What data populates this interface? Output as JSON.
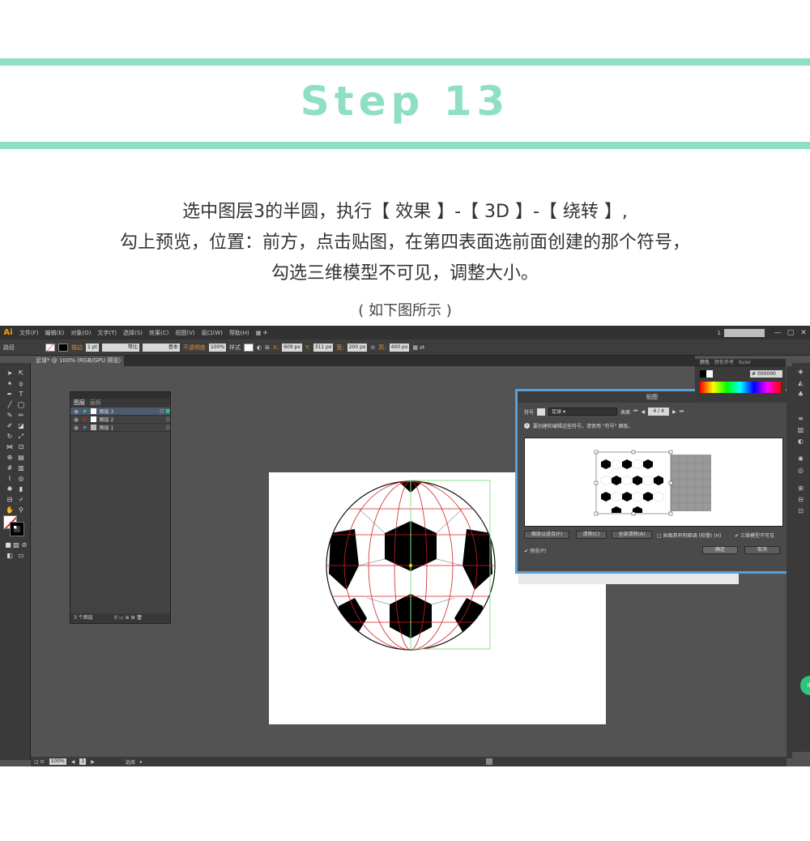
{
  "header": {
    "step_title": "Step 13",
    "instruction_lines": [
      "选中图层3的半圆，执行【 效果 】-【 3D 】-【 绕转 】,",
      "勾上预览，位置：前方，点击贴图，在第四表面选前面创建的那个符号，",
      "勾选三维模型不可见，调整大小。"
    ],
    "caption": "( 如下图所示 )",
    "accent_color": "#8fe0c3"
  },
  "app": {
    "logo": "Ai",
    "menus": [
      "文件(F)",
      "编辑(E)",
      "对象(O)",
      "文字(T)",
      "选择(S)",
      "效果(C)",
      "视图(V)",
      "窗口(W)",
      "帮助(H)"
    ],
    "page_number": "1",
    "window_buttons": [
      "—",
      "▢",
      "✕"
    ]
  },
  "control_bar": {
    "selection_label": "路径",
    "stroke_label": "描边",
    "stroke_weight": "1 pt",
    "profile_label": "等比",
    "brush_label": "基本",
    "opacity_label": "不透明度",
    "opacity_value": "100%",
    "style_label": "样式",
    "x_value": "609 px",
    "y_value": "311 px",
    "w_value": "200 px",
    "h_value": "400 px"
  },
  "document": {
    "tab_title": "足球* @ 100% (RGB/GPU 预览)"
  },
  "layers_panel": {
    "tabs": [
      "图层",
      "画板"
    ],
    "rows": [
      {
        "name": "图层 3",
        "selected": true
      },
      {
        "name": "图层 2",
        "selected": false
      },
      {
        "name": "图层 1",
        "selected": false
      }
    ],
    "footer_text": "3 个图层"
  },
  "color_panel": {
    "tabs": [
      "颜色",
      "颜色参考",
      "Kuler"
    ],
    "hex_value": "000000"
  },
  "map_art_dialog": {
    "title": "贴图",
    "symbol_label": "符号",
    "symbol_value": "足球",
    "surface_label": "表面",
    "surface_value": "4 / 4",
    "info_text": "要创建和编辑这些符号，请使用 \"符号\" 面板。",
    "scale_to_fit_button": "缩放以适合(F)",
    "clear_button": "清除(C)",
    "clear_all_button": "全部清除(A)",
    "shade_artwork_label": "贴图具有明暗调 (较慢) (H)",
    "invisible_geometry_label": "三维模型不可见",
    "invisible_geometry_checked": true,
    "preview_label": "预览(P)",
    "preview_checked": true,
    "ok_button": "确定",
    "cancel_button": "取消"
  },
  "status_bar": {
    "zoom": "100%",
    "page": "1",
    "tool_name": "选择"
  },
  "badge": {
    "text": "IN"
  }
}
